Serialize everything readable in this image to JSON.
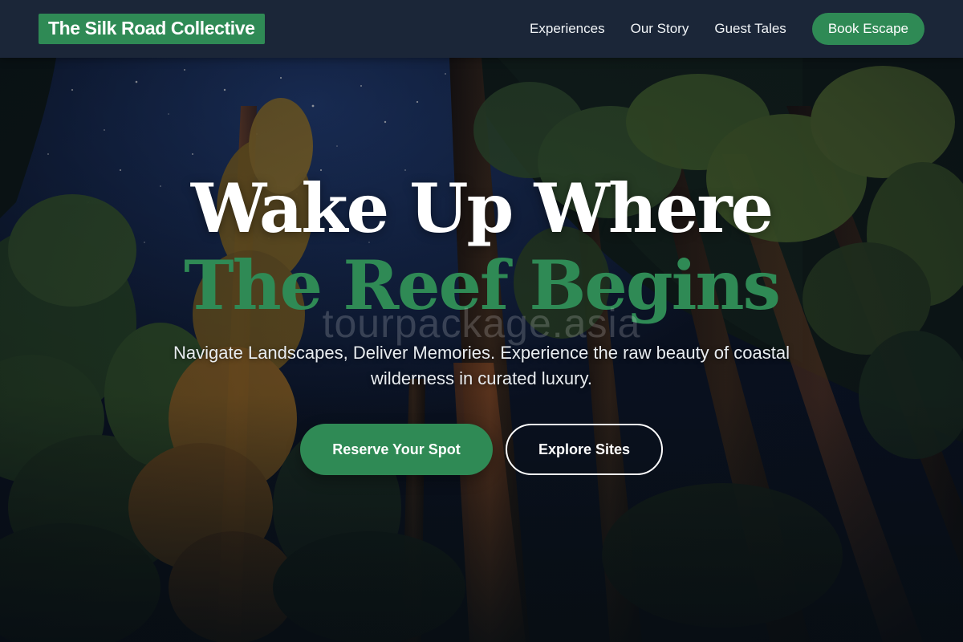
{
  "header": {
    "logo": "The Silk Road Collective",
    "nav": [
      {
        "label": "Experiences"
      },
      {
        "label": "Our Story"
      },
      {
        "label": "Guest Tales"
      }
    ],
    "cta_label": "Book Escape"
  },
  "hero": {
    "headline_line1": "Wake Up Where",
    "headline_line2": "The Reef Begins",
    "watermark": "tourpackage.asia",
    "subtitle": "Navigate Landscapes, Deliver Memories. Experience the raw beauty of coastal wilderness in curated luxury.",
    "primary_button": "Reserve Your Spot",
    "secondary_button": "Explore Sites",
    "background_image": "night-forest-starry-sky"
  },
  "colors": {
    "accent": "#2f8a55",
    "header_bg": "#1b2638",
    "text": "#ffffff"
  }
}
